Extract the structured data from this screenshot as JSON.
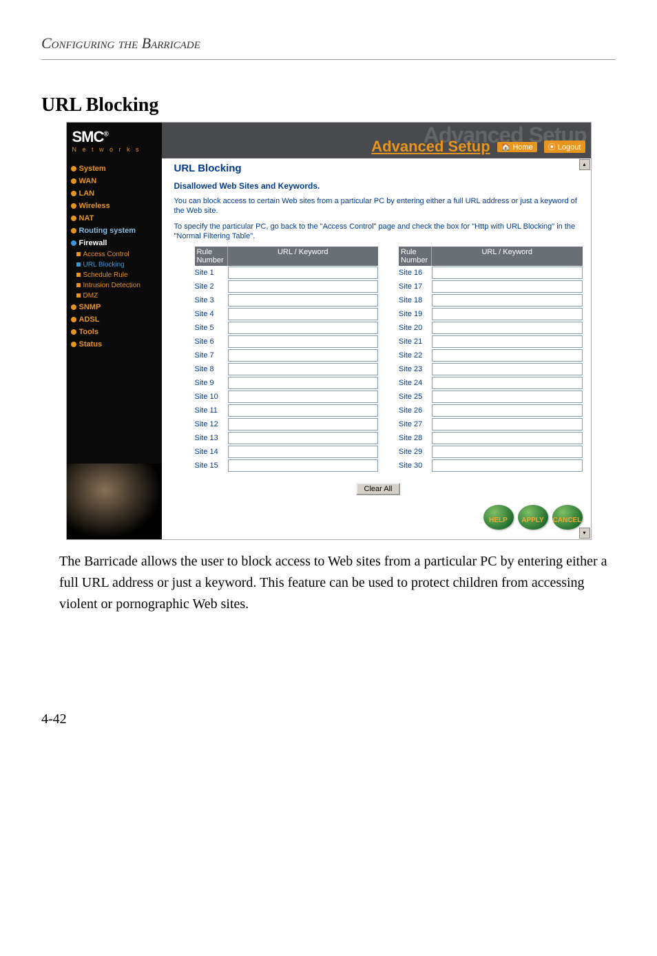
{
  "doc": {
    "chapter_title": "Configuring the Barricade",
    "section_title": "URL Blocking",
    "caption": "The Barricade allows the user to block access to Web sites from a particular PC by entering either a full URL address or just a keyword. This feature can be used to protect children from accessing violent or pornographic Web sites.",
    "page_number": "4-42"
  },
  "banner": {
    "brand": "SMC",
    "brand_sub": "N e t w o r k s",
    "bg_text": "Advanced Setup",
    "title": "Advanced Setup",
    "home": "Home",
    "logout": "Logout"
  },
  "sidebar": {
    "items": [
      {
        "label": "System"
      },
      {
        "label": "WAN"
      },
      {
        "label": "LAN"
      },
      {
        "label": "Wireless"
      },
      {
        "label": "NAT"
      },
      {
        "label": "Routing system"
      }
    ],
    "firewall_label": "Firewall",
    "firewall_subs": [
      {
        "label": "Access Control",
        "cls": "orange"
      },
      {
        "label": "URL Blocking",
        "cls": "blue-sel"
      },
      {
        "label": "Schedule Rule",
        "cls": "orange"
      },
      {
        "label": "Intrusion Detection",
        "cls": "orange"
      },
      {
        "label": "DMZ",
        "cls": "orange"
      }
    ],
    "items_after": [
      {
        "label": "SNMP"
      },
      {
        "label": "ADSL"
      },
      {
        "label": "Tools"
      },
      {
        "label": "Status"
      }
    ]
  },
  "main": {
    "heading": "URL Blocking",
    "sub_heading": "Disallowed Web Sites and Keywords.",
    "desc1": "You can block access to certain Web sites from a particular PC by entering either a full URL address or just a keyword of the Web site.",
    "desc2": "To specify the particular PC, go back to the \"Access Control\" page and check the box for \"Http with URL Blocking\" in the \"Normal Filtering Table\".",
    "col_rule": "Rule Number",
    "col_kw": "URL / Keyword",
    "left_rows": [
      "Site  1",
      "Site  2",
      "Site  3",
      "Site  4",
      "Site  5",
      "Site  6",
      "Site  7",
      "Site  8",
      "Site  9",
      "Site 10",
      "Site 11",
      "Site 12",
      "Site 13",
      "Site 14",
      "Site 15"
    ],
    "right_rows": [
      "Site 16",
      "Site 17",
      "Site 18",
      "Site 19",
      "Site 20",
      "Site 21",
      "Site 22",
      "Site 23",
      "Site 24",
      "Site 25",
      "Site 26",
      "Site 27",
      "Site 28",
      "Site 29",
      "Site 30"
    ],
    "clear": "Clear All",
    "help": "HELP",
    "apply": "APPLY",
    "cancel": "CANCEL"
  }
}
